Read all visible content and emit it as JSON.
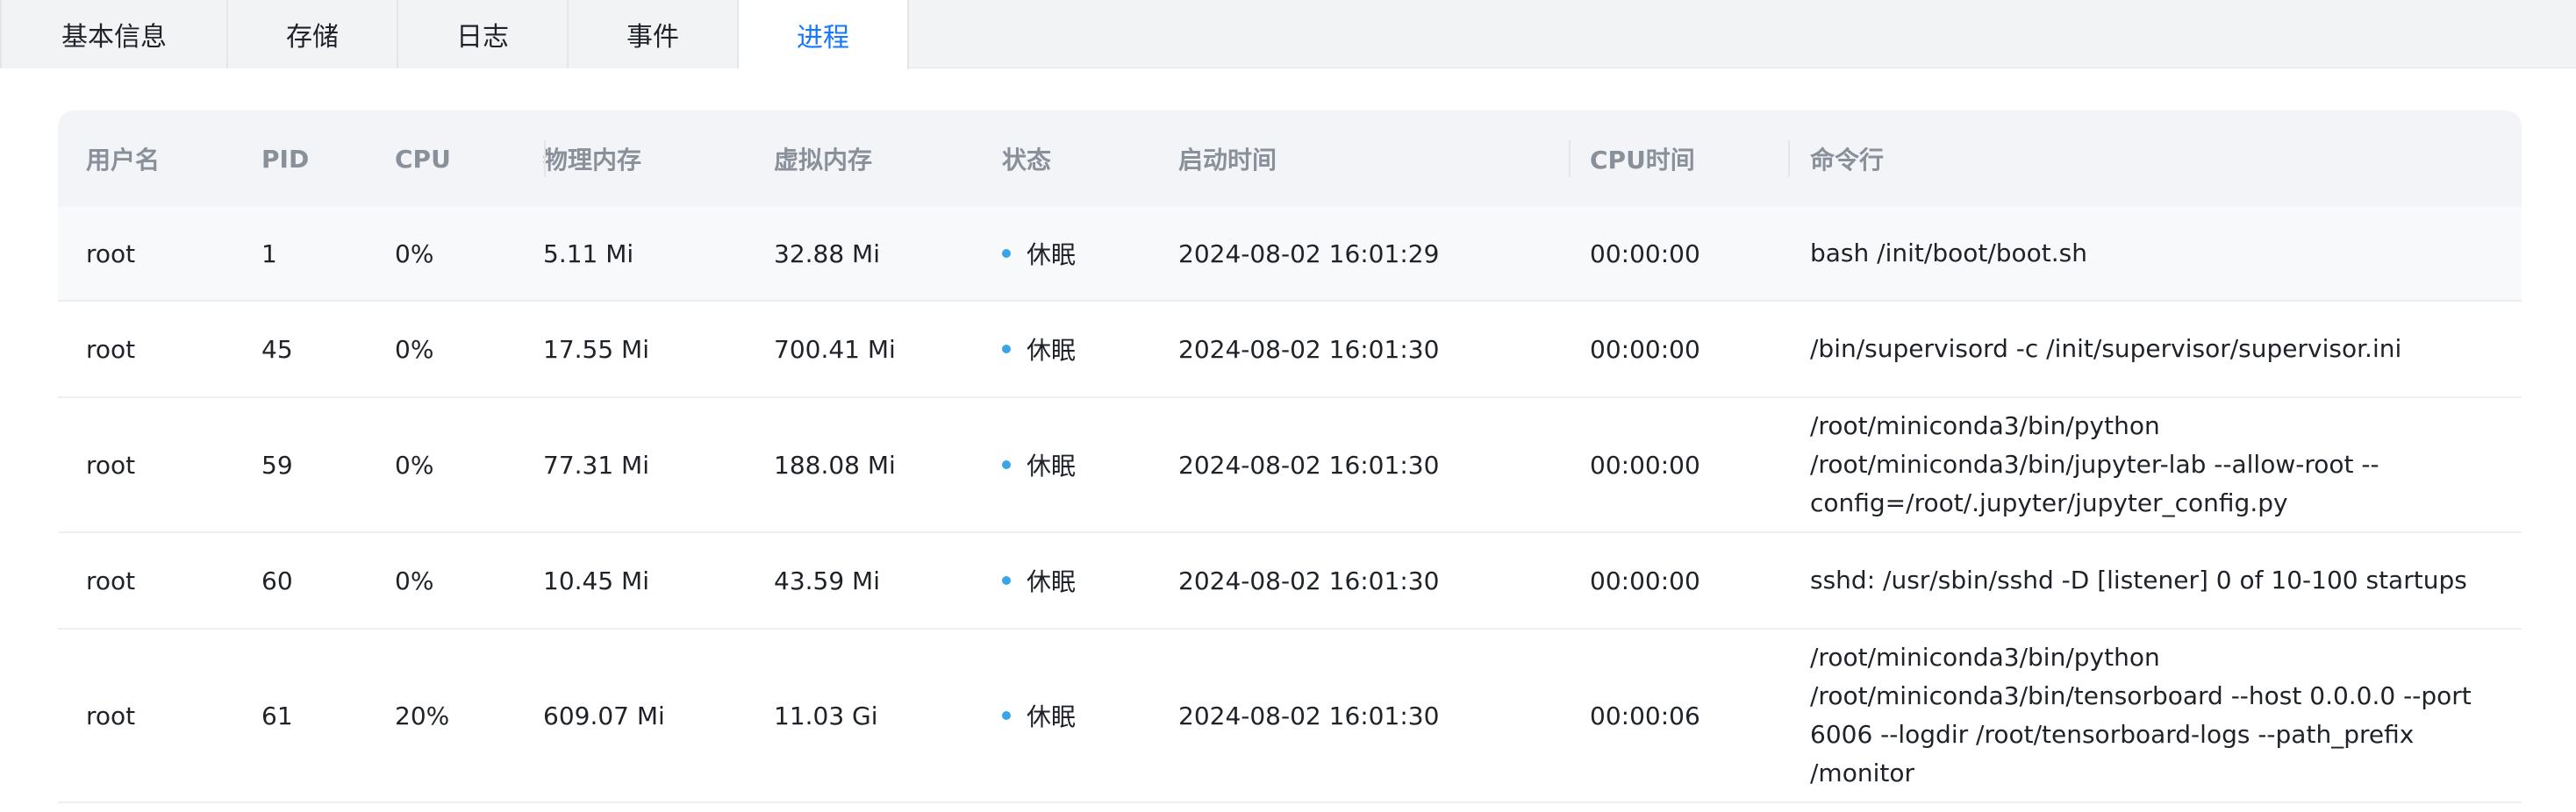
{
  "tabs": [
    {
      "label": "基本信息",
      "active": false
    },
    {
      "label": "存储",
      "active": false
    },
    {
      "label": "日志",
      "active": false
    },
    {
      "label": "事件",
      "active": false
    },
    {
      "label": "进程",
      "active": true
    }
  ],
  "colors": {
    "accent": "#1677ff",
    "status_dot": "#3aa5e6",
    "header_bg": "#f2f4f8"
  },
  "table": {
    "headers": {
      "user": "用户名",
      "pid": "PID",
      "cpu": "CPU",
      "pmem": "物理内存",
      "vmem": "虚拟内存",
      "state": "状态",
      "start": "启动时间",
      "cputime": "CPU时间",
      "cmd": "命令行"
    },
    "rows": [
      {
        "user": "root",
        "pid": "1",
        "cpu": "0%",
        "pmem": "5.11 Mi",
        "vmem": "32.88 Mi",
        "state": "休眠",
        "start": "2024-08-02 16:01:29",
        "cputime": "00:00:00",
        "cmd": "bash /init/boot/boot.sh"
      },
      {
        "user": "root",
        "pid": "45",
        "cpu": "0%",
        "pmem": "17.55 Mi",
        "vmem": "700.41 Mi",
        "state": "休眠",
        "start": "2024-08-02 16:01:30",
        "cputime": "00:00:00",
        "cmd": "/bin/supervisord -c /init/supervisor/supervisor.ini"
      },
      {
        "user": "root",
        "pid": "59",
        "cpu": "0%",
        "pmem": "77.31 Mi",
        "vmem": "188.08 Mi",
        "state": "休眠",
        "start": "2024-08-02 16:01:30",
        "cputime": "00:00:00",
        "cmd": "/root/miniconda3/bin/python /root/miniconda3/bin/jupyter-lab --allow-root --config=/root/.jupyter/jupyter_config.py"
      },
      {
        "user": "root",
        "pid": "60",
        "cpu": "0%",
        "pmem": "10.45 Mi",
        "vmem": "43.59 Mi",
        "state": "休眠",
        "start": "2024-08-02 16:01:30",
        "cputime": "00:00:00",
        "cmd": "sshd: /usr/sbin/sshd -D [listener] 0 of 10-100 startups"
      },
      {
        "user": "root",
        "pid": "61",
        "cpu": "20%",
        "pmem": "609.07 Mi",
        "vmem": "11.03 Gi",
        "state": "休眠",
        "start": "2024-08-02 16:01:30",
        "cputime": "00:00:06",
        "cmd": "/root/miniconda3/bin/python /root/miniconda3/bin/tensorboard --host 0.0.0.0 --port 6006 --logdir /root/tensorboard-logs --path_prefix /monitor"
      }
    ]
  }
}
